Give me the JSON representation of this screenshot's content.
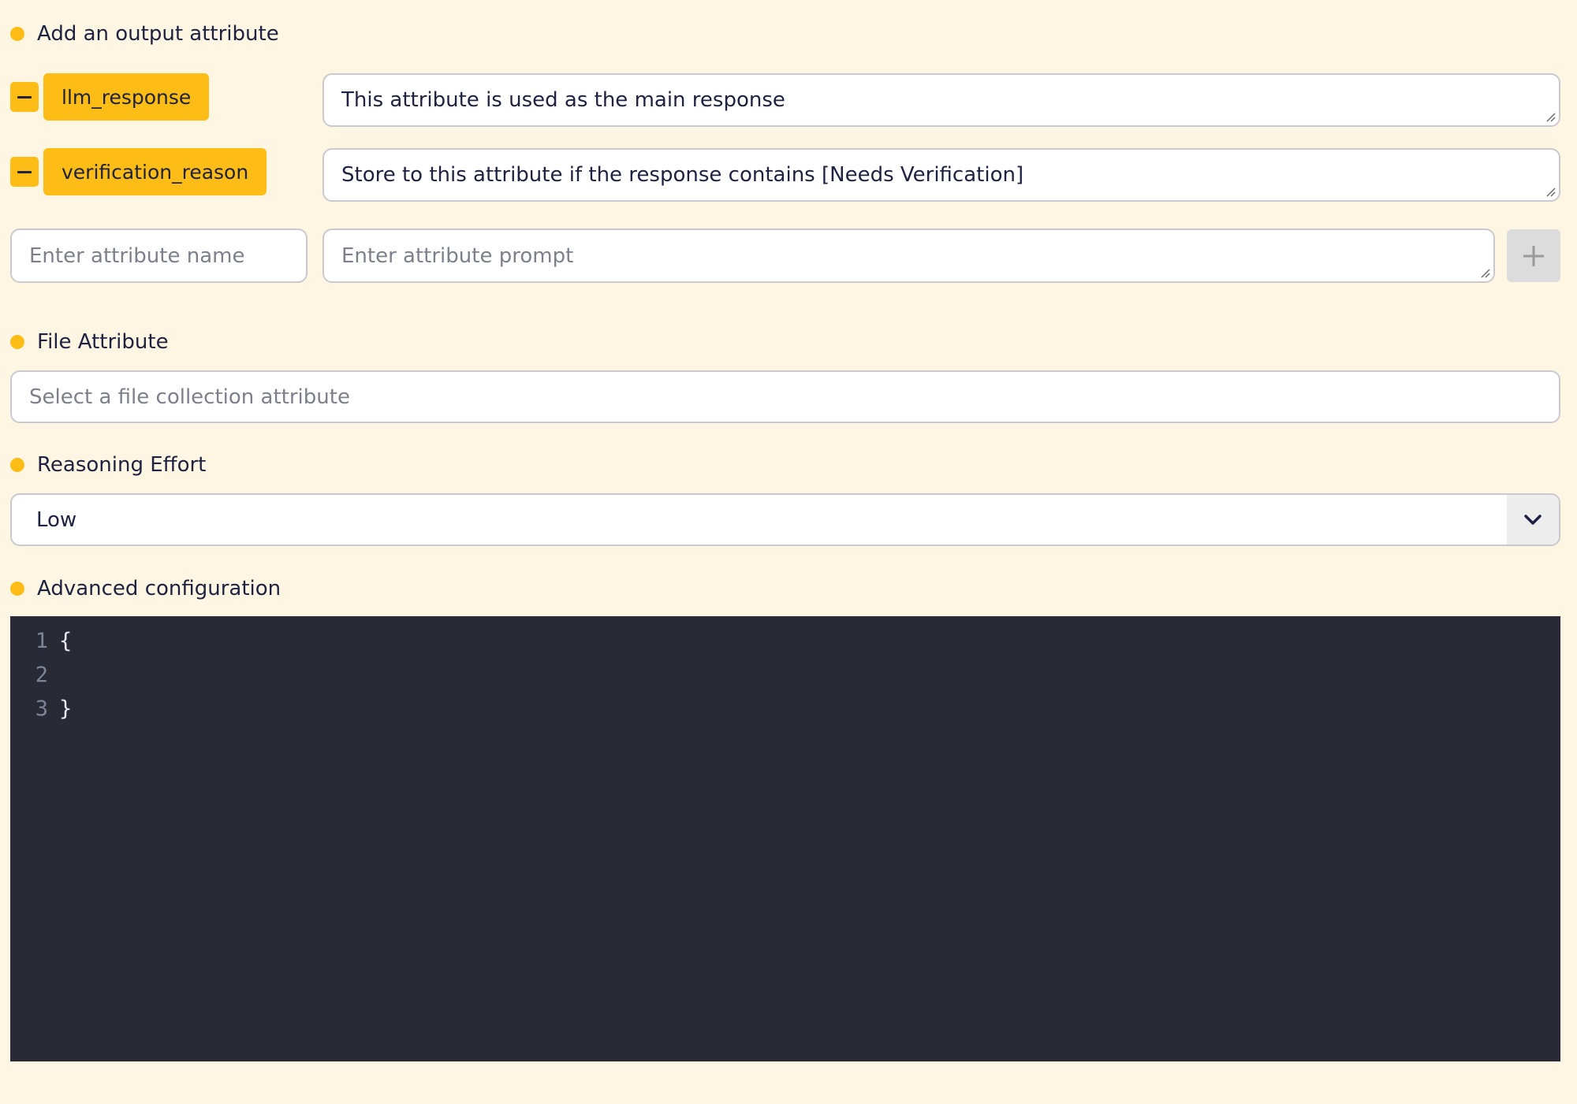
{
  "output_attributes": {
    "label": "Add an output attribute",
    "items": [
      {
        "name": "llm_response",
        "prompt": "This attribute is used as the main response"
      },
      {
        "name": "verification_reason",
        "prompt": "Store to this attribute if the response contains [Needs Verification]"
      }
    ],
    "new_name_placeholder": "Enter attribute name",
    "new_prompt_placeholder": "Enter attribute prompt"
  },
  "file_attribute": {
    "label": "File Attribute",
    "placeholder": "Select a file collection attribute"
  },
  "reasoning_effort": {
    "label": "Reasoning Effort",
    "selected": "Low"
  },
  "advanced_configuration": {
    "label": "Advanced configuration",
    "lines": [
      {
        "number": "1",
        "code": "{"
      },
      {
        "number": "2",
        "code": ""
      },
      {
        "number": "3",
        "code": "}"
      }
    ]
  },
  "colors": {
    "accent": "#fdbd16",
    "background": "#fef6e2",
    "editor_background": "#282a36",
    "text": "#1e2240"
  },
  "icons": {
    "remove": "minus-icon",
    "add": "plus-icon",
    "dropdown": "chevron-down-icon"
  }
}
